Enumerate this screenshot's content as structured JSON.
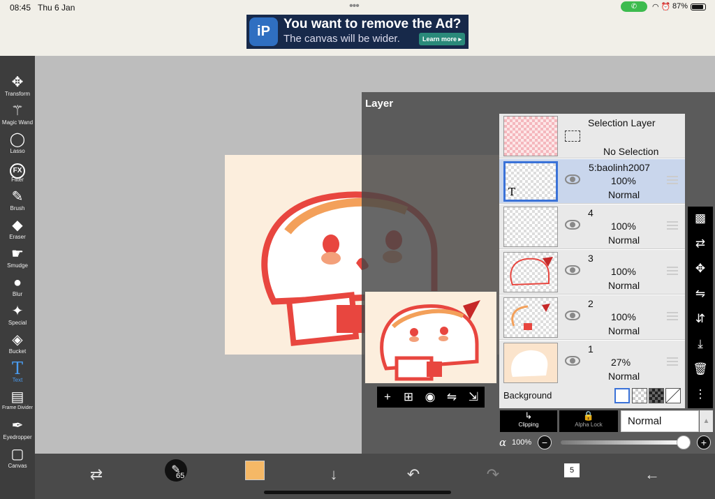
{
  "status": {
    "time": "08:45",
    "date": "Thu 6 Jan",
    "dots": "•••",
    "battery": "87%",
    "call_icon": "phone-icon",
    "icons": "wifi-icon alarm-icon"
  },
  "ad": {
    "logo": "iP",
    "title": "You want to remove the Ad?",
    "subtitle": "The canvas will be wider.",
    "button": "Learn more ▸"
  },
  "tools": [
    {
      "label": "Transform",
      "glyph": "✥"
    },
    {
      "label": "Magic Wand",
      "glyph": "⚚"
    },
    {
      "label": "Lasso",
      "glyph": "◯"
    },
    {
      "label": "Filter",
      "glyph": "FX"
    },
    {
      "label": "Brush",
      "glyph": "✎"
    },
    {
      "label": "Eraser",
      "glyph": "◆"
    },
    {
      "label": "Smudge",
      "glyph": "☛"
    },
    {
      "label": "Blur",
      "glyph": "💧"
    },
    {
      "label": "Special",
      "glyph": "✦"
    },
    {
      "label": "Bucket",
      "glyph": "◈"
    },
    {
      "label": "Text",
      "glyph": "T"
    },
    {
      "label": "Frame Divider",
      "glyph": "▤"
    },
    {
      "label": "Eyedropper",
      "glyph": "✒"
    },
    {
      "label": "Canvas",
      "glyph": "▢"
    }
  ],
  "active_tool": "Text",
  "layer_panel": {
    "title": "Layer",
    "selection": {
      "title": "Selection Layer",
      "status": "No Selection"
    },
    "layers": [
      {
        "name": "5:baolinh2007",
        "opacity": "100%",
        "mode": "Normal",
        "selected": true
      },
      {
        "name": "4",
        "opacity": "100%",
        "mode": "Normal",
        "selected": false
      },
      {
        "name": "3",
        "opacity": "100%",
        "mode": "Normal",
        "selected": false
      },
      {
        "name": "2",
        "opacity": "100%",
        "mode": "Normal",
        "selected": false
      },
      {
        "name": "1",
        "opacity": "27%",
        "mode": "Normal",
        "selected": false
      }
    ],
    "background_label": "Background",
    "clipping_label": "Clipping",
    "alpha_lock_label": "Alpha Lock",
    "blend_mode": "Normal",
    "alpha_symbol": "α",
    "alpha_value": "100%",
    "alpha_fraction": 1.0,
    "minus": "−",
    "plus": "+"
  },
  "preview_toolbar": [
    "+",
    "⊞",
    "📷",
    "⇋",
    "⇲"
  ],
  "right_tools": [
    "checker-icon",
    "transform-layer-icon",
    "move-icon",
    "flip-icon",
    "merge-icon",
    "merge-down-icon",
    "trash-icon",
    "more-icon"
  ],
  "bottom": {
    "brush_size": "65",
    "color": "#f5b866",
    "page_count": "5"
  },
  "colors": {
    "accent": "#3a72d8",
    "text_tool_active": "#4a9cf0",
    "art_bg": "#fceedd",
    "outline": "#e8463f"
  }
}
